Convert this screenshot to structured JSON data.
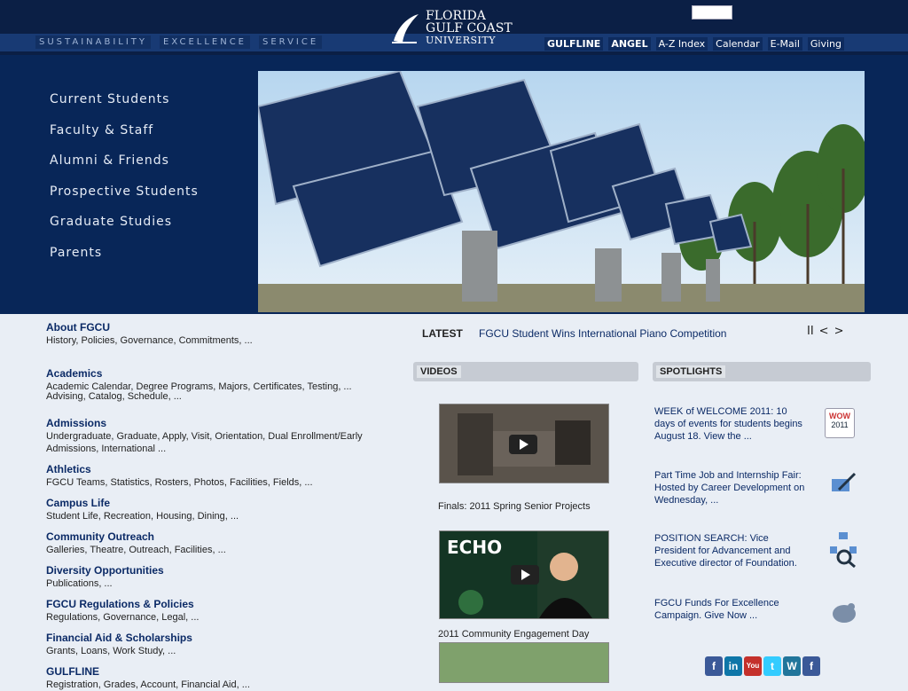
{
  "header": {
    "mottos": [
      "SUSTAINABILITY",
      "EXCELLENCE",
      "SERVICE"
    ],
    "logo": {
      "line1": "FLORIDA",
      "line2": "GULF COAST",
      "line3": "UNIVERSITY"
    },
    "utility_links": [
      "GULFLINE",
      "ANGEL",
      "A-Z Index",
      "Calendar",
      "E-Mail",
      "Giving"
    ]
  },
  "leftnav": [
    "Current Students",
    "Faculty & Staff",
    "Alumni & Friends",
    "Prospective Students",
    "Graduate Studies",
    "Parents"
  ],
  "latest": {
    "label": "LATEST",
    "headline": "FGCU Student Wins International Piano Competition"
  },
  "slider_controls": {
    "pause": "II",
    "prev": "<",
    "next": ">"
  },
  "left_sections": [
    {
      "head": "About FGCU",
      "desc": "History, Policies, Governance, Commitments, ..."
    },
    {
      "head": "Academics",
      "desc": "Academic Calendar, Degree Programs, Majors, Certificates, Testing, ..."
    },
    {
      "head": "",
      "desc": "Advising, Catalog, Schedule, ..."
    },
    {
      "head": "Admissions",
      "desc": "Undergraduate, Graduate, Apply, Visit, Orientation, Dual Enrollment/Early Admissions, International ..."
    },
    {
      "head": "Athletics",
      "desc": "FGCU Teams, Statistics, Rosters, Photos, Facilities, Fields, ..."
    },
    {
      "head": "Campus Life",
      "desc": "Student Life, Recreation, Housing, Dining, ..."
    },
    {
      "head": "Community Outreach",
      "desc": "Galleries, Theatre, Outreach, Facilities, ..."
    },
    {
      "head": "Diversity Opportunities",
      "desc": "Publications, ..."
    },
    {
      "head": "FGCU Regulations & Policies",
      "desc": "Regulations, Governance, Legal, ..."
    },
    {
      "head": "Financial Aid & Scholarships",
      "desc": "Grants, Loans, Work Study, ..."
    },
    {
      "head": "GULFLINE",
      "desc": "Registration, Grades, Account, Financial Aid, ..."
    }
  ],
  "videos": {
    "title": "VIDEOS",
    "items": [
      {
        "caption": "Finals: 2011 Spring Senior Projects"
      },
      {
        "caption": "2011 Community Engagement Day"
      }
    ],
    "echo_text": "ECHO"
  },
  "spotlights": {
    "title": "SPOTLIGHTS",
    "items": [
      {
        "text": "WEEK of WELCOME 2011: 10 days of events for students begins August 18. View the ..."
      },
      {
        "text": "Part Time Job and Internship Fair: Hosted by Career Development on Wednesday, ..."
      },
      {
        "text": "POSITION SEARCH: Vice President for Advancement and Executive director of Foundation."
      },
      {
        "text": "FGCU Funds For Excellence Campaign. Give Now ..."
      }
    ],
    "wow_badge": [
      "WOW",
      "2011"
    ]
  },
  "social": [
    "f",
    "in",
    "You",
    "t",
    "W",
    "f"
  ]
}
